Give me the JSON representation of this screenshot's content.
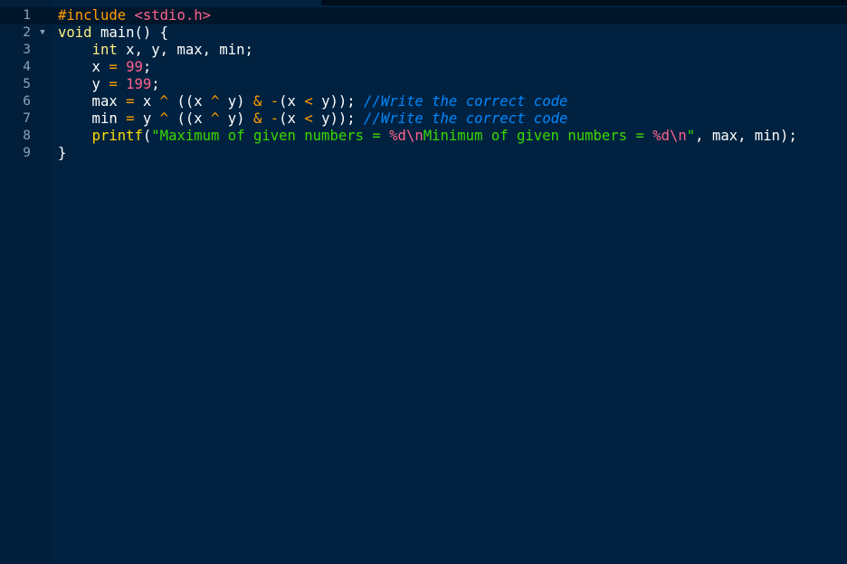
{
  "editor": {
    "lines": [
      {
        "number": "1",
        "tokens": [
          {
            "text": "#include",
            "cls": "t-pre"
          },
          {
            "text": " ",
            "cls": "t-pl"
          },
          {
            "text": "<stdio.h>",
            "cls": "t-inc"
          }
        ]
      },
      {
        "number": "2",
        "tokens": [
          {
            "text": "void",
            "cls": "t-kw"
          },
          {
            "text": " main() {",
            "cls": "t-pl"
          }
        ]
      },
      {
        "number": "3",
        "tokens": [
          {
            "text": "    ",
            "cls": "t-pl"
          },
          {
            "text": "int",
            "cls": "t-kw"
          },
          {
            "text": " x, y, max, min;",
            "cls": "t-pl"
          }
        ]
      },
      {
        "number": "4",
        "tokens": [
          {
            "text": "    x ",
            "cls": "t-pl"
          },
          {
            "text": "=",
            "cls": "t-op"
          },
          {
            "text": " ",
            "cls": "t-pl"
          },
          {
            "text": "99",
            "cls": "t-num"
          },
          {
            "text": ";",
            "cls": "t-pl"
          }
        ]
      },
      {
        "number": "5",
        "tokens": [
          {
            "text": "    y ",
            "cls": "t-pl"
          },
          {
            "text": "=",
            "cls": "t-op"
          },
          {
            "text": " ",
            "cls": "t-pl"
          },
          {
            "text": "199",
            "cls": "t-num"
          },
          {
            "text": ";",
            "cls": "t-pl"
          }
        ]
      },
      {
        "number": "6",
        "tokens": [
          {
            "text": "    max ",
            "cls": "t-pl"
          },
          {
            "text": "=",
            "cls": "t-op"
          },
          {
            "text": " x ",
            "cls": "t-pl"
          },
          {
            "text": "^",
            "cls": "t-op"
          },
          {
            "text": " ((x ",
            "cls": "t-pl"
          },
          {
            "text": "^",
            "cls": "t-op"
          },
          {
            "text": " y) ",
            "cls": "t-pl"
          },
          {
            "text": "&",
            "cls": "t-op"
          },
          {
            "text": " ",
            "cls": "t-pl"
          },
          {
            "text": "-",
            "cls": "t-op"
          },
          {
            "text": "(x ",
            "cls": "t-pl"
          },
          {
            "text": "<",
            "cls": "t-op"
          },
          {
            "text": " y)); ",
            "cls": "t-pl"
          },
          {
            "text": "//Write the correct code",
            "cls": "t-cmt"
          }
        ]
      },
      {
        "number": "7",
        "tokens": [
          {
            "text": "    min ",
            "cls": "t-pl"
          },
          {
            "text": "=",
            "cls": "t-op"
          },
          {
            "text": " y ",
            "cls": "t-pl"
          },
          {
            "text": "^",
            "cls": "t-op"
          },
          {
            "text": " ((x ",
            "cls": "t-pl"
          },
          {
            "text": "^",
            "cls": "t-op"
          },
          {
            "text": " y) ",
            "cls": "t-pl"
          },
          {
            "text": "&",
            "cls": "t-op"
          },
          {
            "text": " ",
            "cls": "t-pl"
          },
          {
            "text": "-",
            "cls": "t-op"
          },
          {
            "text": "(x ",
            "cls": "t-pl"
          },
          {
            "text": "<",
            "cls": "t-op"
          },
          {
            "text": " y)); ",
            "cls": "t-pl"
          },
          {
            "text": "//Write the correct code",
            "cls": "t-cmt"
          }
        ]
      },
      {
        "number": "8",
        "tokens": [
          {
            "text": "    ",
            "cls": "t-pl"
          },
          {
            "text": "printf",
            "cls": "t-fn"
          },
          {
            "text": "(",
            "cls": "t-pl"
          },
          {
            "text": "\"Maximum of given numbers = ",
            "cls": "t-str"
          },
          {
            "text": "%d\\n",
            "cls": "t-esc"
          },
          {
            "text": "Minimum of given numbers = ",
            "cls": "t-str"
          },
          {
            "text": "%d\\n",
            "cls": "t-esc"
          },
          {
            "text": "\"",
            "cls": "t-str"
          },
          {
            "text": ", max, min);",
            "cls": "t-pl"
          }
        ]
      },
      {
        "number": "9",
        "tokens": [
          {
            "text": "}",
            "cls": "t-pl"
          }
        ]
      }
    ],
    "fold_line": "2",
    "active_line": "1",
    "fold_icon": "chevron-down-icon"
  },
  "colors": {
    "background": "#002240",
    "gutter": "#011e3a",
    "active_line": "#00162b",
    "line_number": "#8aa4bb",
    "preprocessor": "#ff9d00",
    "include_path": "#ff628c",
    "keyword": "#ffee80",
    "number": "#ff628c",
    "operator": "#ff9d00",
    "function": "#ffdd00",
    "string": "#3ad900",
    "escape": "#ff628c",
    "comment": "#0088ff",
    "plain": "#ffffff"
  }
}
